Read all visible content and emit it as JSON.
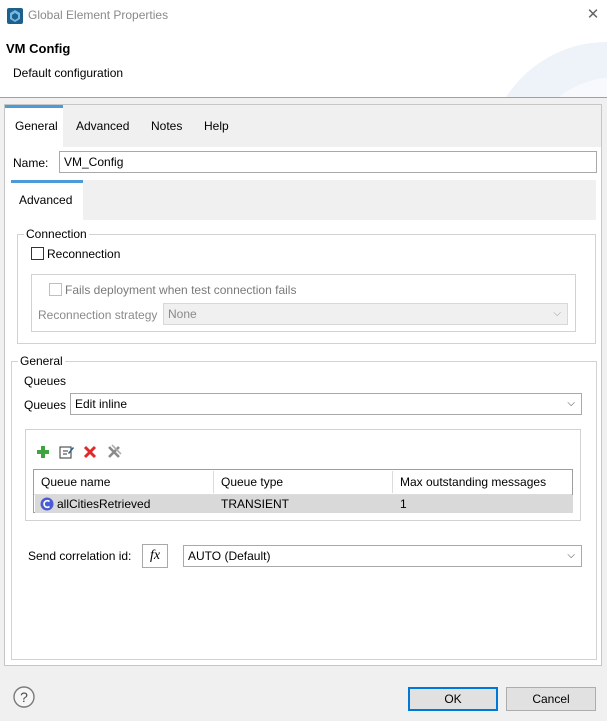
{
  "window": {
    "title": "Global Element Properties"
  },
  "header": {
    "title": "VM Config",
    "description": "Default configuration"
  },
  "tabs": [
    {
      "label": "General",
      "active": true
    },
    {
      "label": "Advanced",
      "active": false
    },
    {
      "label": "Notes",
      "active": false
    },
    {
      "label": "Help",
      "active": false
    }
  ],
  "name_field": {
    "label": "Name:",
    "value": "VM_Config"
  },
  "subtab": {
    "label": "Advanced"
  },
  "connection": {
    "title": "Connection",
    "reconnection_label": "Reconnection",
    "reconnection_checked": false,
    "fails_label": "Fails deployment when test connection fails",
    "strategy_label": "Reconnection strategy",
    "strategy_value": "None"
  },
  "general": {
    "title": "General",
    "queues_heading": "Queues",
    "queues_label": "Queues",
    "queues_value": "Edit inline",
    "toolbar_icons": [
      "add-icon",
      "edit-icon",
      "delete-icon",
      "delete-all-icon"
    ],
    "table": {
      "columns": [
        "Queue name",
        "Queue type",
        "Max outstanding messages"
      ],
      "rows": [
        {
          "name": "allCitiesRetrieved",
          "type": "TRANSIENT",
          "max": "1"
        }
      ]
    },
    "correlation_label": "Send correlation id:",
    "fx_label": "fx",
    "correlation_value": "AUTO (Default)"
  },
  "buttons": {
    "ok": "OK",
    "cancel": "Cancel"
  },
  "colors": {
    "accent": "#4a9bd8",
    "default_button": "#0078d7",
    "selected_row": "#d9d9d9"
  }
}
